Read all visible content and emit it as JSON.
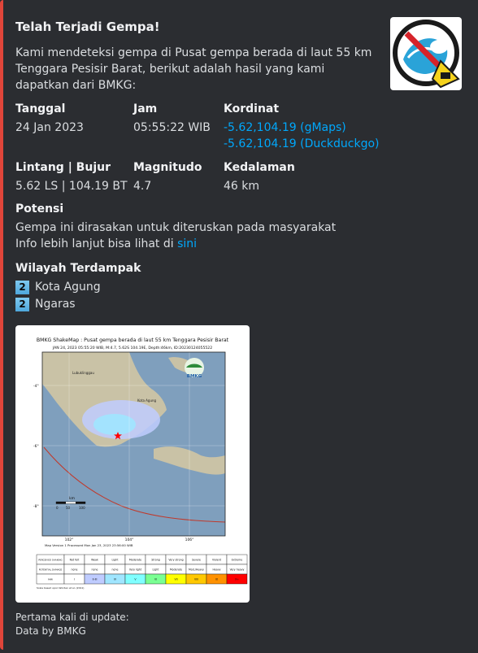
{
  "title": "Telah Terjadi Gempa!",
  "description": "Kami mendeteksi gempa di Pusat gempa berada di laut 55 km Tenggara Pesisir Barat, berikut adalah hasil yang kami dapatkan dari BMKG:",
  "fields": {
    "tanggal": {
      "name": "Tanggal",
      "value": "24 Jan 2023"
    },
    "jam": {
      "name": "Jam",
      "value": "05:55:22 WIB"
    },
    "kordinat": {
      "name": "Kordinat",
      "gmaps": "-5.62,104.19 (gMaps)",
      "duckduckgo": "-5.62,104.19 (Duckduckgo)"
    },
    "lintang_bujur": {
      "name": "Lintang | Bujur",
      "value": "5.62 LS | 104.19 BT"
    },
    "magnitudo": {
      "name": "Magnitudo",
      "value": "4.7"
    },
    "kedalaman": {
      "name": "Kedalaman",
      "value": "46 km"
    },
    "potensi": {
      "name": "Potensi",
      "line1": "Gempa ini dirasakan untuk diteruskan pada masyarakat",
      "line2_prefix": "Info lebih lanjut bisa lihat di ",
      "line2_link": "sini"
    }
  },
  "wilayah": {
    "name": "Wilayah Terdampak",
    "items": [
      {
        "level": "2",
        "label": "Kota Agung"
      },
      {
        "level": "2",
        "label": "Ngaras"
      }
    ]
  },
  "shakemap": {
    "title": "BMKG ShakeMap : Pusat gempa berada di laut 55 km Tenggara Pesisir Barat",
    "subtitle": "JAN 24, 2023 05:55:20 WIB, M:4.7, 5.62S 104.19E, Depth:46km, ID:20230124055522",
    "logo": "BMKG",
    "processed": "Map Version 1 Processed Mon Jan 23, 2023 23:56:00 WIB",
    "lat_ticks": [
      "-4°",
      "-6°",
      "-8°"
    ],
    "lon_ticks": [
      "102°",
      "104°",
      "106°"
    ],
    "scale_unit": "km",
    "scale_ticks": [
      "0",
      "50",
      "100"
    ],
    "places": [
      "Lubuklinggau",
      "Kota Agung"
    ],
    "legend": {
      "row_labels": [
        "PERCEIVED SHAKING",
        "POTENTIAL DAMAGE",
        "MMI"
      ],
      "shaking": [
        "Not felt",
        "Weak",
        "Light",
        "Moderate",
        "Strong",
        "Very strong",
        "Severe",
        "Violent",
        "Extreme"
      ],
      "damage": [
        "none",
        "none",
        "none",
        "Very light",
        "Light",
        "Moderate",
        "Mod./Heavy",
        "Heavy",
        "Very heavy"
      ],
      "mmi": [
        "I",
        "II-III",
        "IV",
        "V",
        "VI",
        "VII",
        "VIII",
        "IX",
        "X+"
      ],
      "colors": [
        "#ffffff",
        "#bfccff",
        "#a0e6ff",
        "#80ffff",
        "#7aff93",
        "#ffff00",
        "#ffc800",
        "#ff9100",
        "#ff0000"
      ]
    },
    "footnote": "Scale based upon Worden et al. (2011)"
  },
  "footer": {
    "line1": "Pertama kali di update:",
    "line2": "Data by BMKG"
  }
}
